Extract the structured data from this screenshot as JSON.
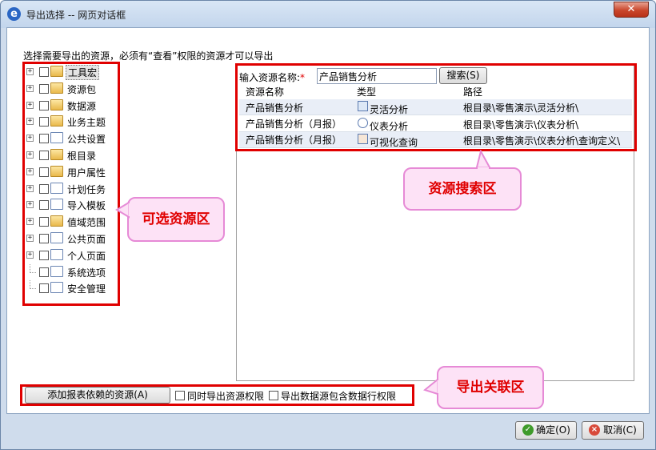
{
  "window": {
    "title": "导出选择 -- 网页对话框",
    "close_label": "✕"
  },
  "instruction": "选择需要导出的资源，必须有“查看”权限的资源才可以导出",
  "tree": {
    "items": [
      {
        "label": "工具宏",
        "icon": "toolbox-folder-icon",
        "expandable": true,
        "selected": true
      },
      {
        "label": "资源包",
        "icon": "folder-icon",
        "expandable": true
      },
      {
        "label": "数据源",
        "icon": "folder-icon",
        "expandable": true
      },
      {
        "label": "业务主题",
        "icon": "folder-icon",
        "expandable": true
      },
      {
        "label": "公共设置",
        "icon": "tools-icon",
        "expandable": true
      },
      {
        "label": "根目录",
        "icon": "folder-icon",
        "expandable": true
      },
      {
        "label": "用户属性",
        "icon": "folder-icon",
        "expandable": true
      },
      {
        "label": "计划任务",
        "icon": "schedule-icon",
        "expandable": true
      },
      {
        "label": "导入模板",
        "icon": "excel-template-icon",
        "expandable": true
      },
      {
        "label": "值域范围",
        "icon": "folder-icon",
        "expandable": true
      },
      {
        "label": "公共页面",
        "icon": "page-icon",
        "expandable": true
      },
      {
        "label": "个人页面",
        "icon": "user-page-icon",
        "expandable": true
      },
      {
        "label": "系统选项",
        "icon": "system-options-icon",
        "expandable": false
      },
      {
        "label": "安全管理",
        "icon": "security-icon",
        "expandable": false
      }
    ]
  },
  "search": {
    "label": "输入资源名称:",
    "required_mark": "*",
    "value": "产品销售分析",
    "button": "搜索(S)"
  },
  "grid": {
    "columns": [
      "资源名称",
      "类型",
      "路径"
    ],
    "rows": [
      {
        "name": "产品销售分析",
        "type": "灵活分析",
        "type_icon": "flexible-analysis-icon",
        "path": "根目录\\零售演示\\灵活分析\\"
      },
      {
        "name": "产品销售分析（月报）",
        "type": "仪表分析",
        "type_icon": "dashboard-icon",
        "path": "根目录\\零售演示\\仪表分析\\"
      },
      {
        "name": "产品销售分析（月报）",
        "type": "可视化查询",
        "type_icon": "visual-query-icon",
        "path": "根目录\\零售演示\\仪表分析\\查询定义\\"
      }
    ]
  },
  "callouts": {
    "selectable": "可选资源区",
    "search": "资源搜索区",
    "export": "导出关联区"
  },
  "bottom": {
    "add_button": "添加报表依赖的资源(A)",
    "cb1": "同时导出资源权限",
    "cb2": "导出数据源包含数据行权限"
  },
  "footer": {
    "ok": "确定(O)",
    "cancel": "取消(C)"
  },
  "colors": {
    "annotation_red": "#e00000",
    "callout_fill": "#fde2f6",
    "callout_border": "#e68ad6"
  }
}
